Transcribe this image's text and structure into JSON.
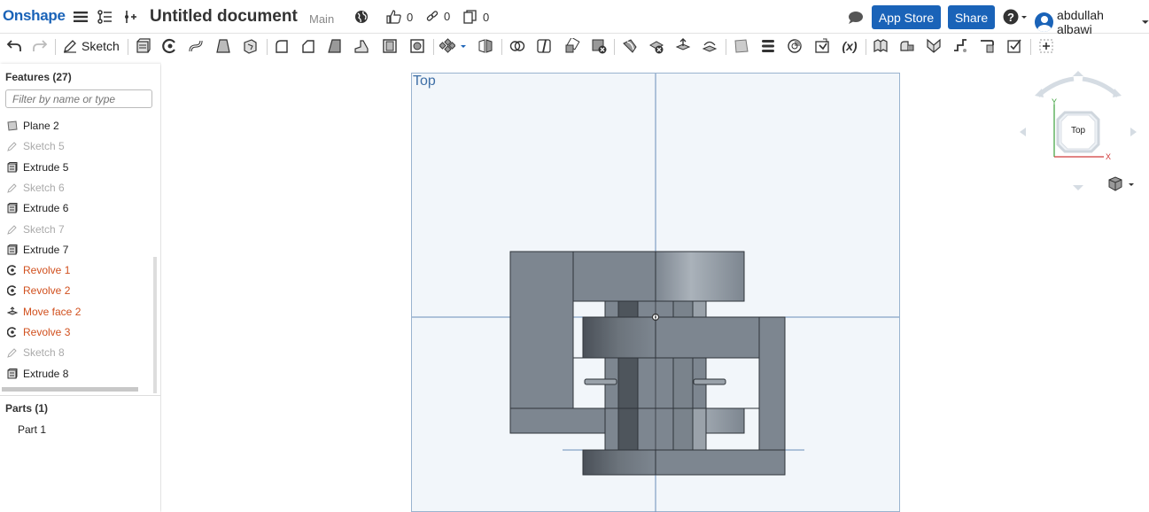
{
  "topbar": {
    "logo": "Onshape",
    "document_title": "Untitled document",
    "branch": "Main",
    "likes": "0",
    "links": "0",
    "copies": "0",
    "app_store_label": "App Store",
    "share_label": "Share",
    "user_name": "abdullah albawi"
  },
  "toolbar": {
    "sketch_label": "Sketch",
    "variable_label": "(x)"
  },
  "features": {
    "title": "Features (27)",
    "filter_placeholder": "Filter by name or type",
    "items": [
      {
        "label": "Plane 2",
        "state": "normal",
        "icon": "plane-icon"
      },
      {
        "label": "Sketch 5",
        "state": "dim",
        "icon": "sketch-icon"
      },
      {
        "label": "Extrude 5",
        "state": "normal",
        "icon": "extrude-icon"
      },
      {
        "label": "Sketch 6",
        "state": "dim",
        "icon": "sketch-icon"
      },
      {
        "label": "Extrude 6",
        "state": "normal",
        "icon": "extrude-icon"
      },
      {
        "label": "Sketch 7",
        "state": "dim",
        "icon": "sketch-icon"
      },
      {
        "label": "Extrude 7",
        "state": "normal",
        "icon": "extrude-icon"
      },
      {
        "label": "Revolve 1",
        "state": "error",
        "icon": "revolve-icon"
      },
      {
        "label": "Revolve 2",
        "state": "error",
        "icon": "revolve-icon"
      },
      {
        "label": "Move face 2",
        "state": "error",
        "icon": "move-face-icon"
      },
      {
        "label": "Revolve 3",
        "state": "error",
        "icon": "revolve-icon"
      },
      {
        "label": "Sketch 8",
        "state": "dim",
        "icon": "sketch-icon"
      },
      {
        "label": "Extrude 8",
        "state": "normal",
        "icon": "extrude-icon"
      }
    ]
  },
  "parts": {
    "title": "Parts (1)",
    "items": [
      "Part 1"
    ]
  },
  "viewport": {
    "plane_label": "Top",
    "view_cube_label": "Top",
    "axis_y": "Y",
    "axis_x": "X"
  },
  "colors": {
    "brand": "#1a63b8",
    "error_text": "#d1501e",
    "plane_fill": "#f2f6fa",
    "model_gray": "#7d8690"
  }
}
